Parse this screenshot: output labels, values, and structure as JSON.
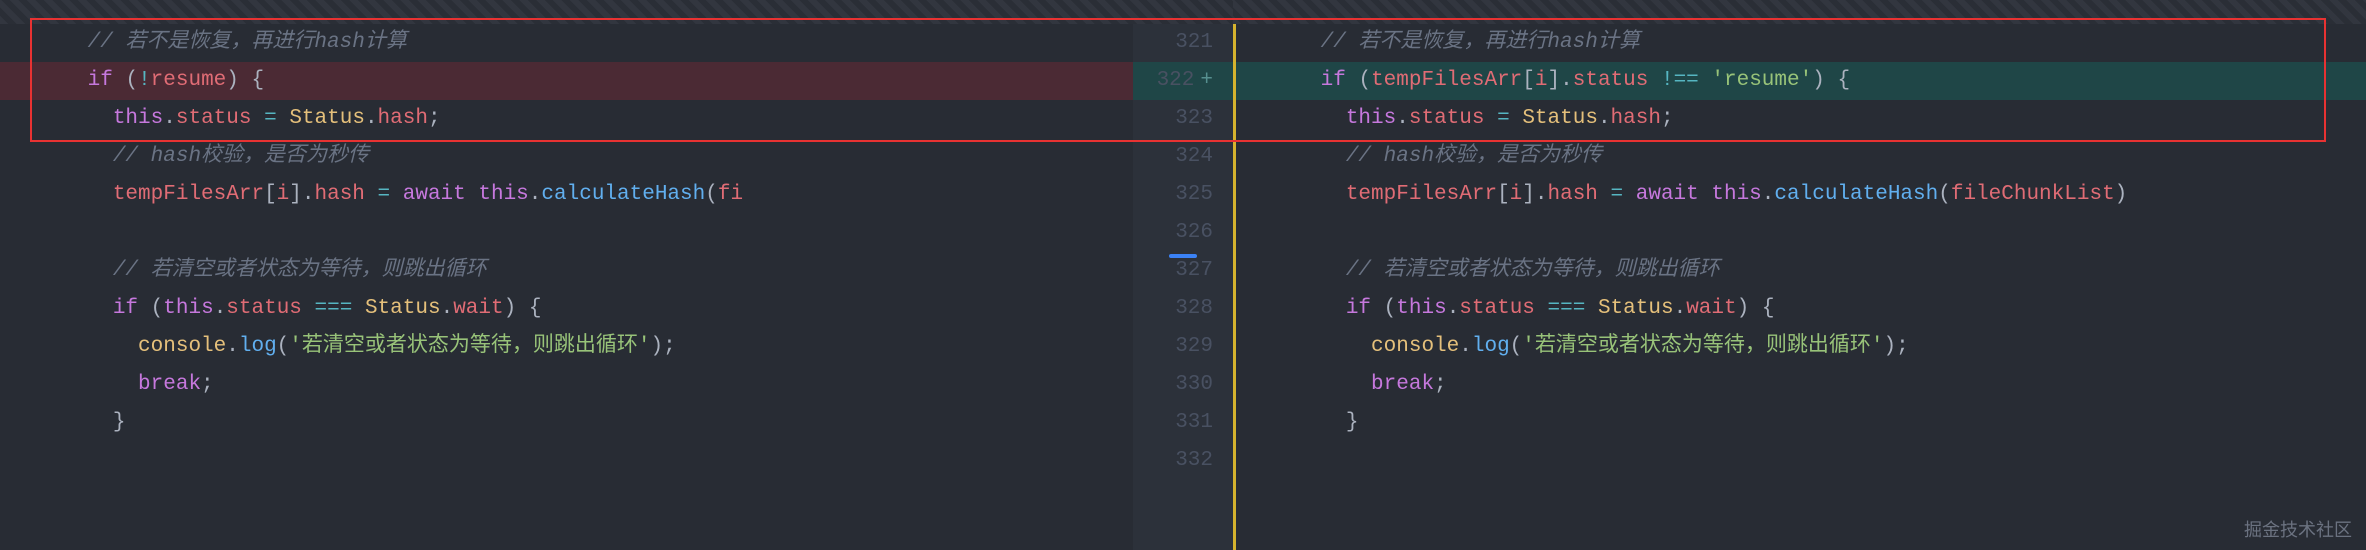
{
  "left": {
    "lines": [
      {
        "num": "",
        "cls": "",
        "tokens": [
          [
            "indent",
            "      "
          ],
          [
            "comment",
            "// 若不是恢复，再进行hash计算"
          ]
        ]
      },
      {
        "num": "",
        "cls": "line-removed",
        "tokens": [
          [
            "indent",
            "      "
          ],
          [
            "keyword",
            "if"
          ],
          [
            "plain",
            " "
          ],
          [
            "punct",
            "("
          ],
          [
            "op",
            "!"
          ],
          [
            "prop",
            "resume"
          ],
          [
            "punct",
            ")"
          ],
          [
            "plain",
            " "
          ],
          [
            "punct",
            "{"
          ]
        ]
      },
      {
        "num": "",
        "cls": "",
        "tokens": [
          [
            "indent",
            "        "
          ],
          [
            "keyword",
            "this"
          ],
          [
            "punct",
            "."
          ],
          [
            "prop",
            "status"
          ],
          [
            "plain",
            " "
          ],
          [
            "op",
            "="
          ],
          [
            "plain",
            " "
          ],
          [
            "var",
            "Status"
          ],
          [
            "punct",
            "."
          ],
          [
            "prop",
            "hash"
          ],
          [
            "punct",
            ";"
          ]
        ]
      },
      {
        "num": "",
        "cls": "",
        "tokens": [
          [
            "indent",
            "        "
          ],
          [
            "comment",
            "// hash校验，是否为秒传"
          ]
        ]
      },
      {
        "num": "",
        "cls": "",
        "tokens": [
          [
            "indent",
            "        "
          ],
          [
            "prop",
            "tempFilesArr"
          ],
          [
            "punct",
            "["
          ],
          [
            "prop",
            "i"
          ],
          [
            "punct",
            "]"
          ],
          [
            "punct",
            "."
          ],
          [
            "prop",
            "hash"
          ],
          [
            "plain",
            " "
          ],
          [
            "op",
            "="
          ],
          [
            "plain",
            " "
          ],
          [
            "keyword",
            "await"
          ],
          [
            "plain",
            " "
          ],
          [
            "keyword",
            "this"
          ],
          [
            "punct",
            "."
          ],
          [
            "func",
            "calculateHash"
          ],
          [
            "punct",
            "("
          ],
          [
            "prop",
            "fi"
          ]
        ]
      },
      {
        "num": "",
        "cls": "",
        "tokens": []
      },
      {
        "num": "",
        "cls": "",
        "tokens": [
          [
            "indent",
            "        "
          ],
          [
            "comment",
            "// 若清空或者状态为等待，则跳出循环"
          ]
        ]
      },
      {
        "num": "",
        "cls": "",
        "tokens": [
          [
            "indent",
            "        "
          ],
          [
            "keyword",
            "if"
          ],
          [
            "plain",
            " "
          ],
          [
            "punct",
            "("
          ],
          [
            "keyword",
            "this"
          ],
          [
            "punct",
            "."
          ],
          [
            "prop",
            "status"
          ],
          [
            "plain",
            " "
          ],
          [
            "op",
            "==="
          ],
          [
            "plain",
            " "
          ],
          [
            "var",
            "Status"
          ],
          [
            "punct",
            "."
          ],
          [
            "prop",
            "wait"
          ],
          [
            "punct",
            ")"
          ],
          [
            "plain",
            " "
          ],
          [
            "punct",
            "{"
          ]
        ]
      },
      {
        "num": "",
        "cls": "",
        "tokens": [
          [
            "indent",
            "          "
          ],
          [
            "var",
            "console"
          ],
          [
            "punct",
            "."
          ],
          [
            "func",
            "log"
          ],
          [
            "punct",
            "("
          ],
          [
            "string",
            "'若清空或者状态为等待，则跳出循环'"
          ],
          [
            "punct",
            ")"
          ],
          [
            "punct",
            ";"
          ]
        ]
      },
      {
        "num": "",
        "cls": "",
        "tokens": [
          [
            "indent",
            "          "
          ],
          [
            "keyword",
            "break"
          ],
          [
            "punct",
            ";"
          ]
        ]
      },
      {
        "num": "",
        "cls": "",
        "tokens": [
          [
            "indent",
            "        "
          ],
          [
            "punct",
            "}"
          ]
        ]
      }
    ]
  },
  "right": {
    "lines": [
      {
        "num": "321",
        "cls": "",
        "tokens": [
          [
            "indent",
            "      "
          ],
          [
            "comment",
            "// 若不是恢复，再进行hash计算"
          ]
        ]
      },
      {
        "num": "322",
        "cls": "line-added",
        "marker": "+",
        "tokens": [
          [
            "indent",
            "      "
          ],
          [
            "keyword",
            "if"
          ],
          [
            "plain",
            " "
          ],
          [
            "punct",
            "("
          ],
          [
            "prop",
            "tempFilesArr"
          ],
          [
            "punct",
            "["
          ],
          [
            "prop",
            "i"
          ],
          [
            "punct",
            "]"
          ],
          [
            "punct",
            "."
          ],
          [
            "prop",
            "status"
          ],
          [
            "plain",
            " "
          ],
          [
            "op",
            "!=="
          ],
          [
            "plain",
            " "
          ],
          [
            "string",
            "'resume'"
          ],
          [
            "punct",
            ")"
          ],
          [
            "plain",
            " "
          ],
          [
            "punct",
            "{"
          ]
        ]
      },
      {
        "num": "323",
        "cls": "",
        "tokens": [
          [
            "indent",
            "        "
          ],
          [
            "keyword",
            "this"
          ],
          [
            "punct",
            "."
          ],
          [
            "prop",
            "status"
          ],
          [
            "plain",
            " "
          ],
          [
            "op",
            "="
          ],
          [
            "plain",
            " "
          ],
          [
            "var",
            "Status"
          ],
          [
            "punct",
            "."
          ],
          [
            "prop",
            "hash"
          ],
          [
            "punct",
            ";"
          ]
        ]
      },
      {
        "num": "324",
        "cls": "",
        "tokens": [
          [
            "indent",
            "        "
          ],
          [
            "comment",
            "// hash校验，是否为秒传"
          ]
        ]
      },
      {
        "num": "325",
        "cls": "",
        "tokens": [
          [
            "indent",
            "        "
          ],
          [
            "prop",
            "tempFilesArr"
          ],
          [
            "punct",
            "["
          ],
          [
            "prop",
            "i"
          ],
          [
            "punct",
            "]"
          ],
          [
            "punct",
            "."
          ],
          [
            "prop",
            "hash"
          ],
          [
            "plain",
            " "
          ],
          [
            "op",
            "="
          ],
          [
            "plain",
            " "
          ],
          [
            "keyword",
            "await"
          ],
          [
            "plain",
            " "
          ],
          [
            "keyword",
            "this"
          ],
          [
            "punct",
            "."
          ],
          [
            "func",
            "calculateHash"
          ],
          [
            "punct",
            "("
          ],
          [
            "prop",
            "fileChunkList"
          ],
          [
            "punct",
            ")"
          ]
        ]
      },
      {
        "num": "326",
        "cls": "",
        "tokens": []
      },
      {
        "num": "327",
        "cls": "",
        "tokens": [
          [
            "indent",
            "        "
          ],
          [
            "comment",
            "// 若清空或者状态为等待，则跳出循环"
          ]
        ]
      },
      {
        "num": "328",
        "cls": "",
        "tokens": [
          [
            "indent",
            "        "
          ],
          [
            "keyword",
            "if"
          ],
          [
            "plain",
            " "
          ],
          [
            "punct",
            "("
          ],
          [
            "keyword",
            "this"
          ],
          [
            "punct",
            "."
          ],
          [
            "prop",
            "status"
          ],
          [
            "plain",
            " "
          ],
          [
            "op",
            "==="
          ],
          [
            "plain",
            " "
          ],
          [
            "var",
            "Status"
          ],
          [
            "punct",
            "."
          ],
          [
            "prop",
            "wait"
          ],
          [
            "punct",
            ")"
          ],
          [
            "plain",
            " "
          ],
          [
            "punct",
            "{"
          ]
        ]
      },
      {
        "num": "329",
        "cls": "",
        "tokens": [
          [
            "indent",
            "          "
          ],
          [
            "var",
            "console"
          ],
          [
            "punct",
            "."
          ],
          [
            "func",
            "log"
          ],
          [
            "punct",
            "("
          ],
          [
            "string",
            "'若清空或者状态为等待，则跳出循环'"
          ],
          [
            "punct",
            ")"
          ],
          [
            "punct",
            ";"
          ]
        ]
      },
      {
        "num": "330",
        "cls": "",
        "tokens": [
          [
            "indent",
            "          "
          ],
          [
            "keyword",
            "break"
          ],
          [
            "punct",
            ";"
          ]
        ]
      },
      {
        "num": "331",
        "cls": "",
        "tokens": [
          [
            "indent",
            "        "
          ],
          [
            "punct",
            "}"
          ]
        ]
      },
      {
        "num": "332",
        "cls": "",
        "tokens": []
      }
    ]
  },
  "watermark": "掘金技术社区"
}
